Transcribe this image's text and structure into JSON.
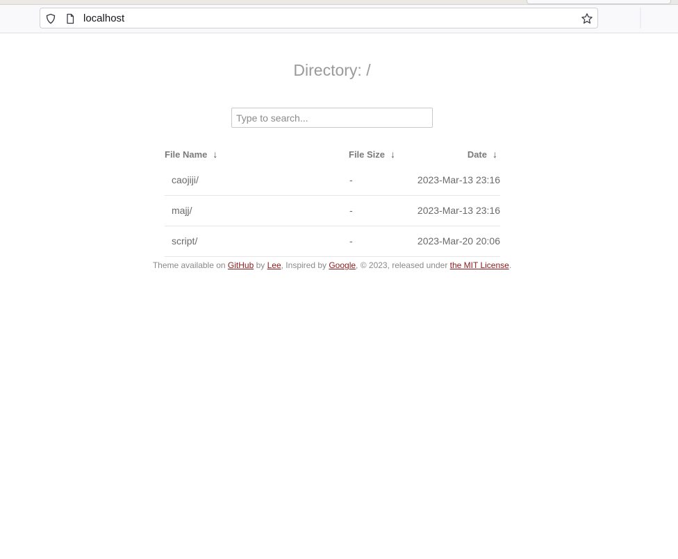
{
  "browser": {
    "url": "localhost"
  },
  "page": {
    "title": "Directory: /",
    "search_placeholder": "Type to search..."
  },
  "table": {
    "columns": [
      {
        "label": "File Name",
        "sort_icon": "↓"
      },
      {
        "label": "File Size",
        "sort_icon": "↓"
      },
      {
        "label": "Date",
        "sort_icon": "↓"
      }
    ],
    "rows": [
      {
        "name": "caojiji/",
        "size": "-",
        "date": "2023-Mar-13 23:16"
      },
      {
        "name": "majj/",
        "size": "-",
        "date": "2023-Mar-13 23:16"
      },
      {
        "name": "script/",
        "size": "-",
        "date": "2023-Mar-20 20:06"
      }
    ]
  },
  "footer": {
    "text1": "Theme available on ",
    "github": "GitHub",
    "text2": " by ",
    "lee": "Lee",
    "text3": ", Inspired by ",
    "google": "Google",
    "text4": ", © 2023, released under ",
    "license": "the MIT License",
    "text5": "."
  },
  "colors": {
    "link": "#8b1a1a",
    "text": "#6a6a6a"
  }
}
